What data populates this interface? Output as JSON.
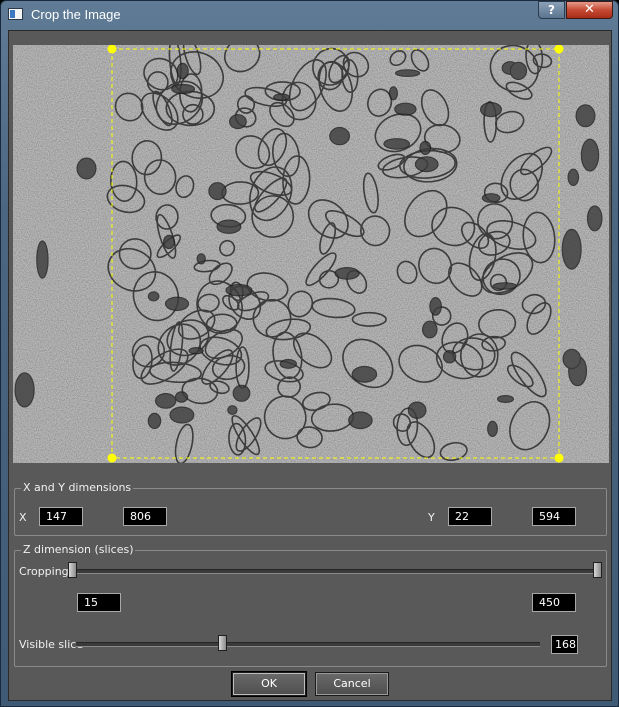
{
  "window": {
    "title": "Crop the Image",
    "help_label": "?",
    "close_label": "✕"
  },
  "image_view": {
    "crop_color": "#ffff00",
    "description_icon": "em-microscopy-image"
  },
  "xy_group": {
    "title": "X and Y dimensions",
    "x_label": "X",
    "x_min": "147",
    "x_max": "806",
    "y_label": "Y",
    "y_min": "22",
    "y_max": "594"
  },
  "z_group": {
    "title": "Z dimension (slices)",
    "cropping_label": "Cropping",
    "z_min": "15",
    "z_max": "450",
    "visible_slice_label": "Visible slice",
    "visible_slice": "168"
  },
  "buttons": {
    "ok": "OK",
    "cancel": "Cancel"
  }
}
